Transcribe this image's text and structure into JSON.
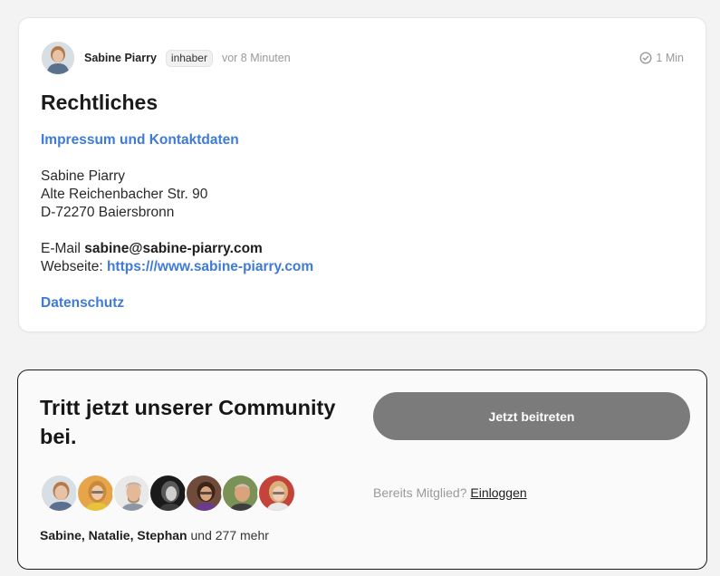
{
  "post": {
    "author": {
      "name": "Sabine Piarry",
      "role_badge": "inhaber",
      "time_ago": "vor 8 Minuten"
    },
    "read_time": "1 Min",
    "title": "Rechtliches",
    "section_impressum": "Impressum und Kontaktdaten",
    "address": {
      "line1": "Sabine Piarry",
      "line2": "Alte Reichenbacher Str. 90",
      "line3": "D-72270 Baiersbronn"
    },
    "contact": {
      "email_label": "E-Mail",
      "email_value": "sabine@sabine-piarry.com",
      "website_label": "Webseite:",
      "website_value": "https:///www.sabine-piarry.com"
    },
    "section_privacy": "Datenschutz"
  },
  "community": {
    "title": "Tritt jetzt unserer Community bei.",
    "join_button": "Jetzt beitreten",
    "already_member": "Bereits Mitglied?",
    "login_link": "Einloggen",
    "members_names": "Sabine, Natalie, Stephan",
    "members_more": "und 277 mehr"
  },
  "colors": {
    "link_blue": "#3e7bd8",
    "button_gray": "#7b7b7b",
    "muted_text": "#9a9a9a"
  },
  "icons": {
    "read_time": "check-circle-icon"
  }
}
